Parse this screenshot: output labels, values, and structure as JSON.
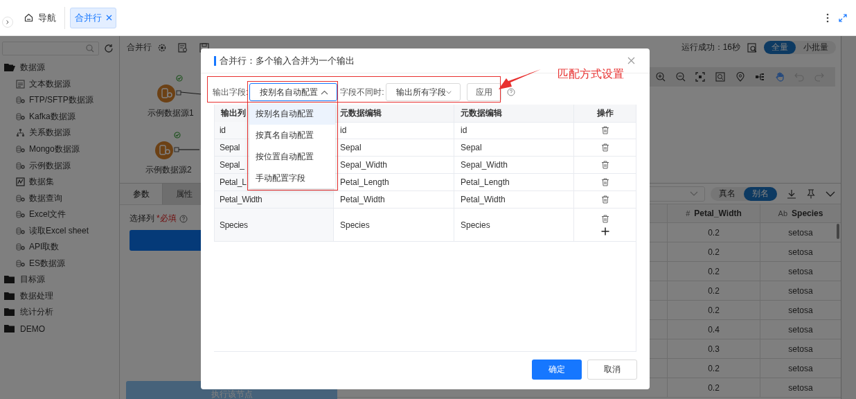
{
  "top_bar": {
    "nav": "导航",
    "tabs": [
      {
        "label": "合并行",
        "selected": true
      }
    ]
  },
  "sidebar": {
    "tree": [
      {
        "label": "数据源",
        "expanded": true,
        "children": [
          {
            "label": "文本数据源",
            "kind": "text"
          },
          {
            "label": "FTP/SFTP数据源",
            "kind": "db"
          },
          {
            "label": "Kafka数据源",
            "kind": "db"
          },
          {
            "label": "关系数据源",
            "kind": "relation"
          },
          {
            "label": "Mongo数据源",
            "kind": "db"
          },
          {
            "label": "示例数据源",
            "kind": "db"
          },
          {
            "label": "数据集",
            "kind": "dataset"
          },
          {
            "label": "数据查询",
            "kind": "db"
          },
          {
            "label": "Excel文件",
            "kind": "db"
          },
          {
            "label": "读取Excel sheet",
            "kind": "db"
          },
          {
            "label": "API取数",
            "kind": "db"
          },
          {
            "label": "ES数据源",
            "kind": "db"
          }
        ]
      },
      {
        "label": "目标源",
        "expanded": false
      },
      {
        "label": "数据处理",
        "expanded": false
      },
      {
        "label": "统计分析",
        "expanded": false
      },
      {
        "label": "DEMO",
        "expanded": false
      }
    ]
  },
  "canvas": {
    "title": "合并行",
    "run_status": "运行成功：16秒",
    "modes": [
      {
        "label": "全量",
        "selected": true
      },
      {
        "label": "小批量",
        "selected": false
      }
    ],
    "nodes": [
      {
        "label": "示例数据源1"
      },
      {
        "label": "示例数据源2"
      }
    ]
  },
  "params_panel": {
    "tabs": [
      {
        "label": "参数",
        "selected": true
      },
      {
        "label": "属性",
        "selected": false
      }
    ],
    "field_label": "选择列",
    "required": "*必填",
    "run_button": "执行该节点"
  },
  "data_panel": {
    "name_modes": [
      {
        "label": "真名",
        "selected": false
      },
      {
        "label": "别名",
        "selected": true
      }
    ],
    "columns": [
      {
        "type_mark": "#",
        "label": "Petal_Width"
      },
      {
        "type_mark": "Ab",
        "label": "Species"
      }
    ],
    "rows": [
      [
        "0.2",
        "setosa"
      ],
      [
        "0.2",
        "setosa"
      ],
      [
        "0.2",
        "setosa"
      ],
      [
        "0.2",
        "setosa"
      ],
      [
        "0.2",
        "setosa"
      ],
      [
        "0.4",
        "setosa"
      ],
      [
        "0.3",
        "setosa"
      ],
      [
        "0.2",
        "setosa"
      ],
      [
        "0.2",
        "setosa"
      ]
    ]
  },
  "dialog": {
    "title": "合并行：多个输入合并为一个输出",
    "output_field": {
      "label": "输出字段:",
      "value": "按别名自动配置",
      "open": true,
      "options": [
        {
          "label": "按别名自动配置",
          "selected": true
        },
        {
          "label": "按真名自动配置",
          "selected": false
        },
        {
          "label": "按位置自动配置",
          "selected": false
        },
        {
          "label": "手动配置字段",
          "selected": false
        }
      ]
    },
    "mismatch_field": {
      "label": "字段不同时:",
      "value": "输出所有字段",
      "open": false
    },
    "apply_button": "应用",
    "table": {
      "columns": [
        "输出列",
        "元数据编辑",
        "元数据编辑",
        "操作"
      ],
      "rows": [
        [
          "id",
          "id",
          "id"
        ],
        [
          "Sepal",
          "Sepal",
          "Sepal"
        ],
        [
          "Sepal_",
          "Sepal_Width",
          "Sepal_Width"
        ],
        [
          "Petal_L",
          "Petal_Length",
          "Petal_Length"
        ],
        [
          "Petal_Width",
          "Petal_Width",
          "Petal_Width"
        ],
        [
          "Species",
          "Species",
          "Species"
        ]
      ]
    },
    "buttons": [
      {
        "label": "确定",
        "kind": "primary"
      },
      {
        "label": "取消",
        "kind": "default"
      }
    ]
  },
  "annotation": {
    "text": "匹配方式设置"
  }
}
